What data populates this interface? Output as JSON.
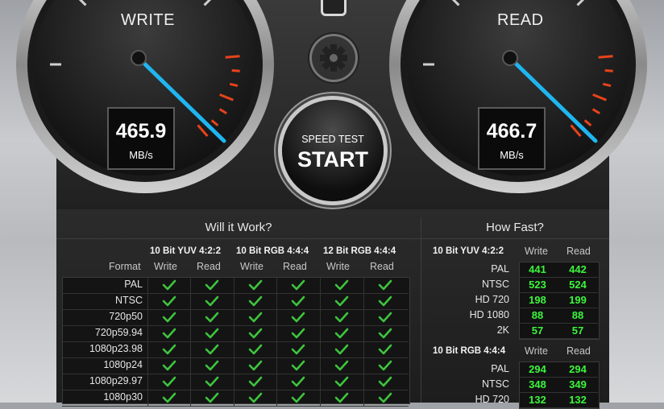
{
  "write_gauge": {
    "label": "WRITE",
    "value": "465.9",
    "unit": "MB/s"
  },
  "read_gauge": {
    "label": "READ",
    "value": "466.7",
    "unit": "MB/s"
  },
  "start_button": {
    "top_label": "SPEED TEST",
    "main_label": "START"
  },
  "will_it_work": {
    "title": "Will it Work?",
    "format_header": "Format",
    "groups": [
      "10 Bit YUV 4:2:2",
      "10 Bit RGB 4:4:4",
      "12 Bit RGB 4:4:4"
    ],
    "write_label": "Write",
    "read_label": "Read",
    "formats": [
      "PAL",
      "NTSC",
      "720p50",
      "720p59.94",
      "1080p23.98",
      "1080p24",
      "1080p29.97",
      "1080p30"
    ]
  },
  "how_fast": {
    "title": "How Fast?",
    "write_label": "Write",
    "read_label": "Read",
    "sections": [
      {
        "name": "10 Bit YUV 4:2:2",
        "rows": [
          {
            "format": "PAL",
            "write": "441",
            "read": "442"
          },
          {
            "format": "NTSC",
            "write": "523",
            "read": "524"
          },
          {
            "format": "HD 720",
            "write": "198",
            "read": "199"
          },
          {
            "format": "HD 1080",
            "write": "88",
            "read": "88"
          },
          {
            "format": "2K",
            "write": "57",
            "read": "57"
          }
        ]
      },
      {
        "name": "10 Bit RGB 4:4:4",
        "rows": [
          {
            "format": "PAL",
            "write": "294",
            "read": "294"
          },
          {
            "format": "NTSC",
            "write": "348",
            "read": "349"
          },
          {
            "format": "HD 720",
            "write": "132",
            "read": "132"
          }
        ]
      }
    ]
  },
  "colors": {
    "value_green": "#3cf53c",
    "needle_blue": "#1fb6f0",
    "redline": "#e8431a",
    "check_green": "#3ec43e"
  }
}
